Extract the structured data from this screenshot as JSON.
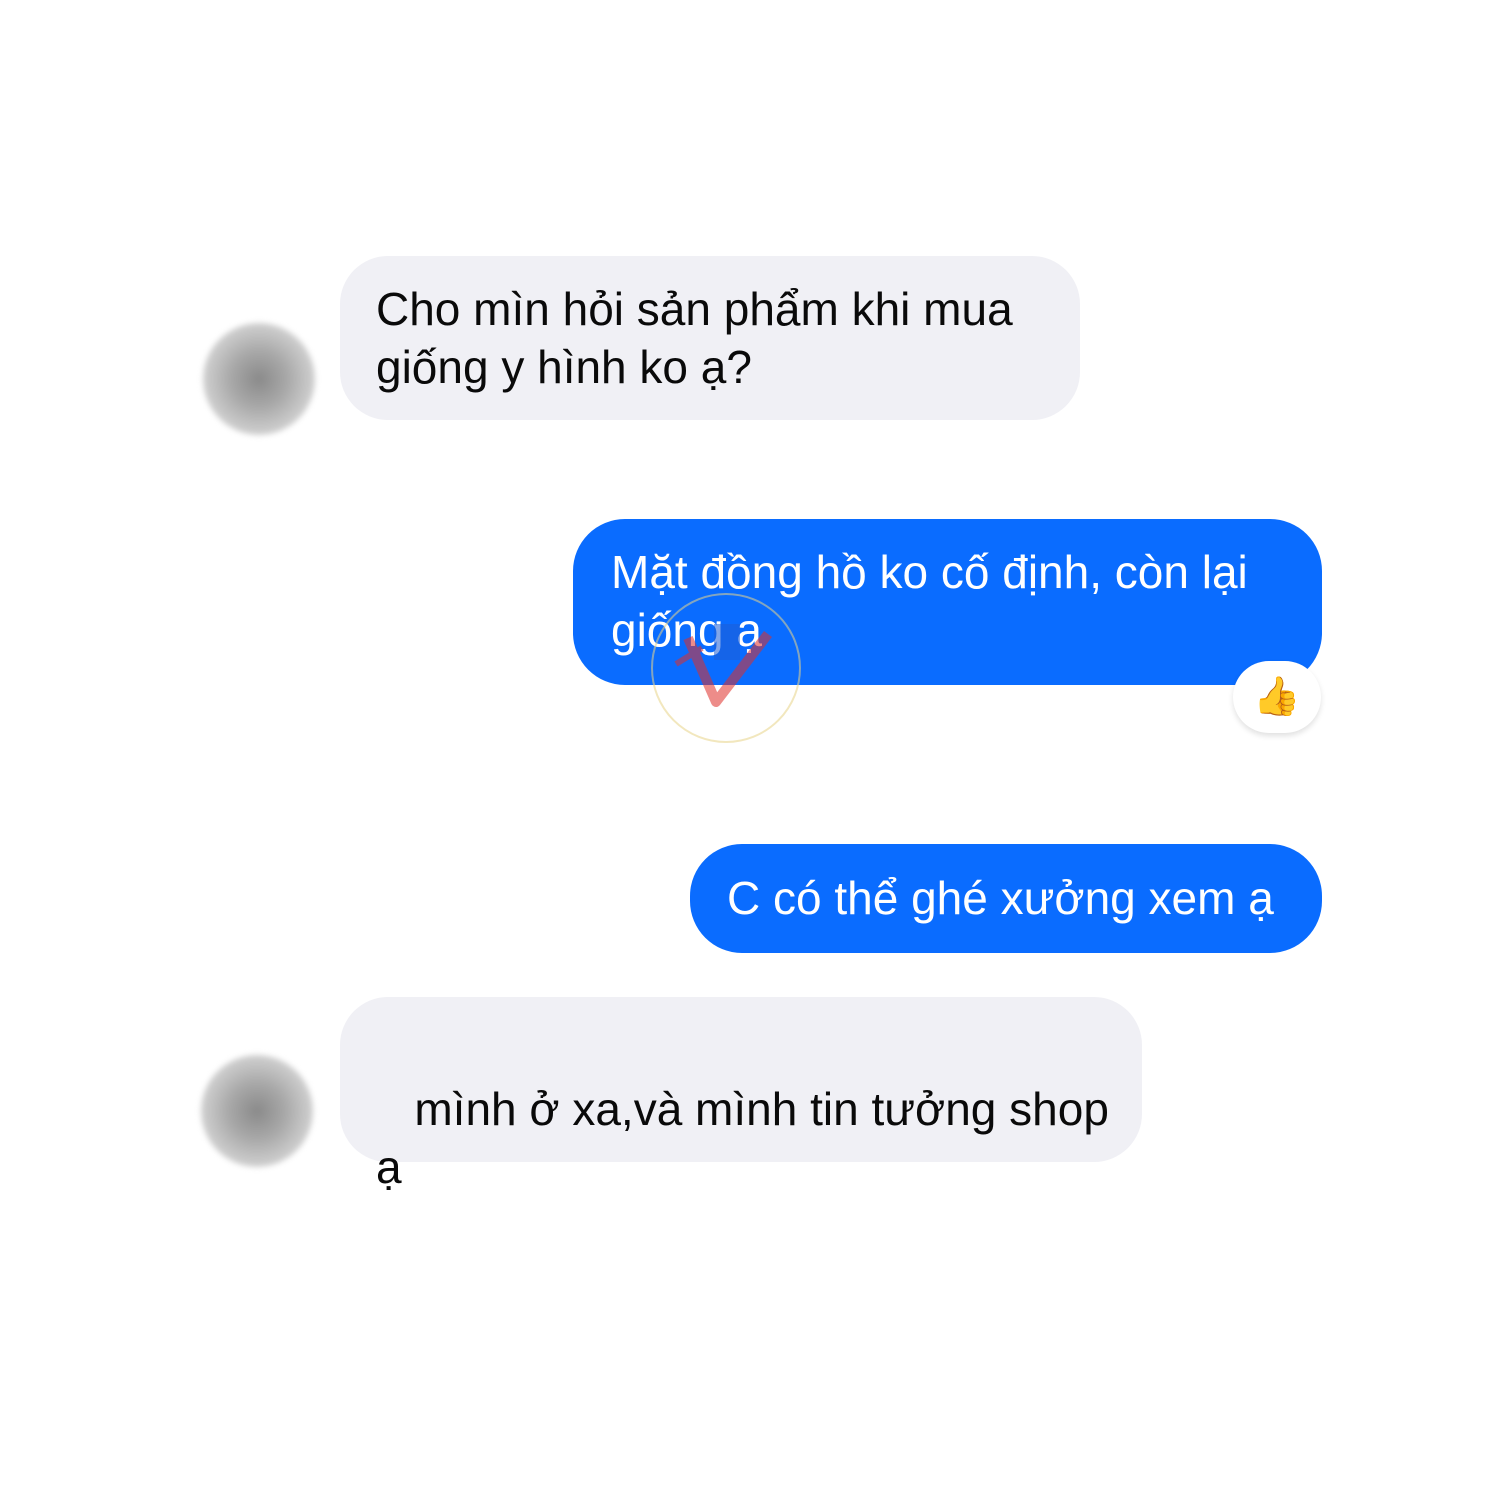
{
  "conversation": {
    "messages": [
      {
        "sender": "other",
        "text": "Cho mìn hỏi sản phẩm khi mua giống y hình ko ạ?"
      },
      {
        "sender": "me",
        "text": "Mặt đồng hồ ko cố định, còn lại giống ạ",
        "reaction": "👍"
      },
      {
        "sender": "me",
        "text": "C có thể ghé xưởng xem ạ"
      },
      {
        "sender": "other",
        "text": " mình ở xa,và mình tin tưởng shop ạ"
      }
    ]
  },
  "colors": {
    "incoming_bubble": "#f0f0f5",
    "outgoing_bubble": "#0a6cff",
    "incoming_text": "#0a0a0a",
    "outgoing_text": "#ffffff"
  },
  "icons": {
    "reaction": "thumbs-up-icon",
    "watermark": "logo-watermark"
  }
}
